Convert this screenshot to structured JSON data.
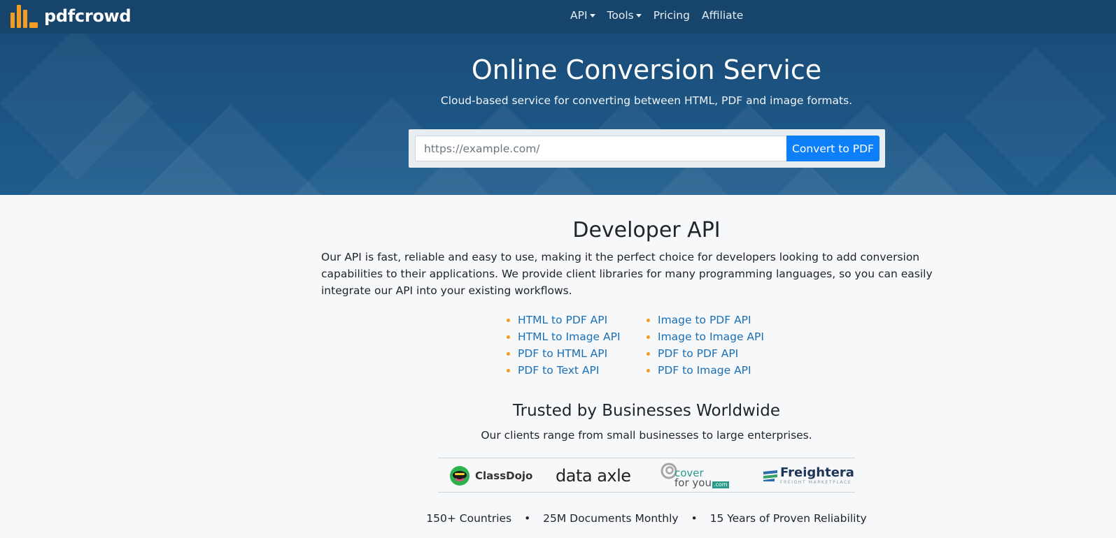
{
  "brand": {
    "name": "pdfcrowd",
    "logo_icon": "bar-chart-logo-icon",
    "accent_color": "#f39c1f"
  },
  "nav": {
    "items": [
      {
        "label": "API",
        "has_dropdown": true
      },
      {
        "label": "Tools",
        "has_dropdown": true
      },
      {
        "label": "Pricing",
        "has_dropdown": false
      },
      {
        "label": "Affiliate",
        "has_dropdown": false
      }
    ]
  },
  "hero": {
    "title": "Online Conversion Service",
    "subtitle": "Cloud-based service for converting between HTML, PDF and image formats.",
    "url_placeholder": "https://example.com/",
    "url_value": "",
    "convert_label": "Convert to PDF",
    "button_color": "#0d7ff8"
  },
  "developer": {
    "title": "Developer API",
    "description": "Our API is fast, reliable and easy to use, making it the perfect choice for developers looking to add conversion capabilities to their applications. We provide client libraries for many programming languages, so you can easily integrate our API into your existing workflows.",
    "apis_left": [
      "HTML to PDF API",
      "HTML to Image API",
      "PDF to HTML API",
      "PDF to Text API"
    ],
    "apis_right": [
      "Image to PDF API",
      "Image to Image API",
      "PDF to PDF API",
      "PDF to Image API"
    ]
  },
  "trusted": {
    "title": "Trusted by Businesses Worldwide",
    "subtitle": "Our clients range from small businesses to large enterprises.",
    "clients": {
      "classdojo": "ClassDojo",
      "dataaxle": "data axle",
      "coverforyou_line1": "cover",
      "coverforyou_line2": "for you",
      "coverforyou_com": ".com",
      "freightera": "Freightera",
      "freightera_tagline": "FREIGHT MARKETPLACE"
    },
    "stats": [
      "150+ Countries",
      "25M Documents Monthly",
      "15 Years of Proven Reliability"
    ],
    "stat_separator": "•"
  }
}
